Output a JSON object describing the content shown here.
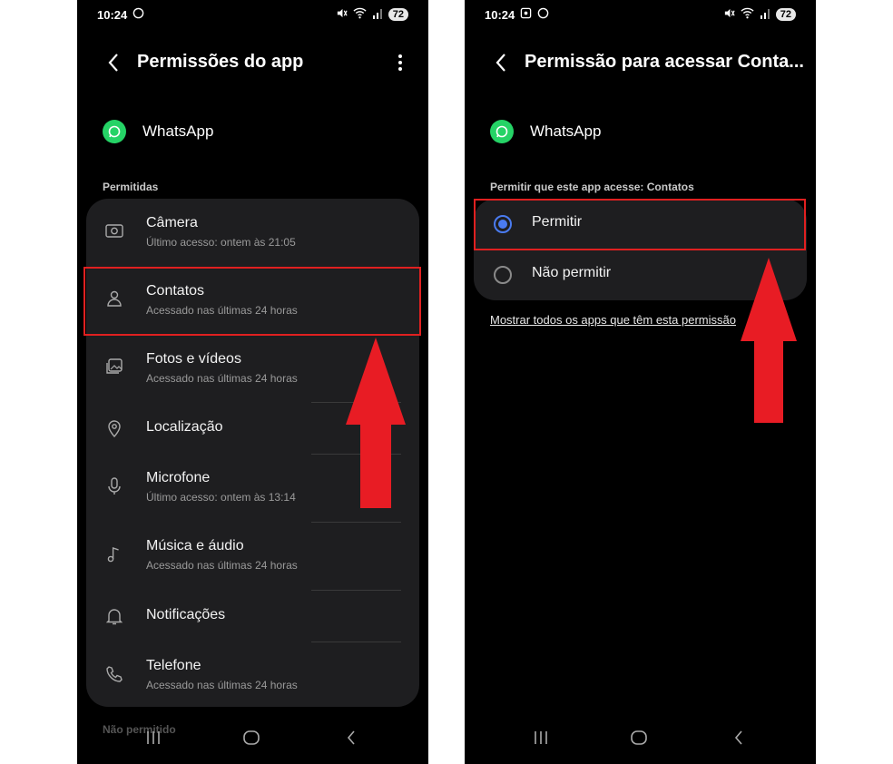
{
  "status": {
    "time": "10:24",
    "battery": "72"
  },
  "left": {
    "title": "Permissões do app",
    "app_name": "WhatsApp",
    "section_allowed": "Permitidas",
    "section_denied": "Não permitido",
    "items": [
      {
        "label": "Câmera",
        "sub": "Último acesso: ontem às 21:05",
        "icon": "camera-icon"
      },
      {
        "label": "Contatos",
        "sub": "Acessado nas últimas 24 horas",
        "icon": "person-icon"
      },
      {
        "label": "Fotos e vídeos",
        "sub": "Acessado nas últimas 24 horas",
        "icon": "photos-icon"
      },
      {
        "label": "Localização",
        "sub": "",
        "icon": "location-icon"
      },
      {
        "label": "Microfone",
        "sub": "Último acesso: ontem às 13:14",
        "icon": "microphone-icon"
      },
      {
        "label": "Música e áudio",
        "sub": "Acessado nas últimas 24 horas",
        "icon": "music-icon"
      },
      {
        "label": "Notificações",
        "sub": "",
        "icon": "bell-icon"
      },
      {
        "label": "Telefone",
        "sub": "Acessado nas últimas 24 horas",
        "icon": "phone-icon"
      }
    ]
  },
  "right": {
    "title": "Permissão para acessar Conta...",
    "app_name": "WhatsApp",
    "section_label": "Permitir que este app acesse: Contatos",
    "options": [
      {
        "label": "Permitir",
        "selected": true
      },
      {
        "label": "Não permitir",
        "selected": false
      }
    ],
    "link": "Mostrar todos os apps que têm esta permissão"
  },
  "colors": {
    "highlight": "#e02020",
    "arrow": "#e81c24",
    "radio_selected": "#4a7bf0",
    "whatsapp": "#25d366"
  }
}
